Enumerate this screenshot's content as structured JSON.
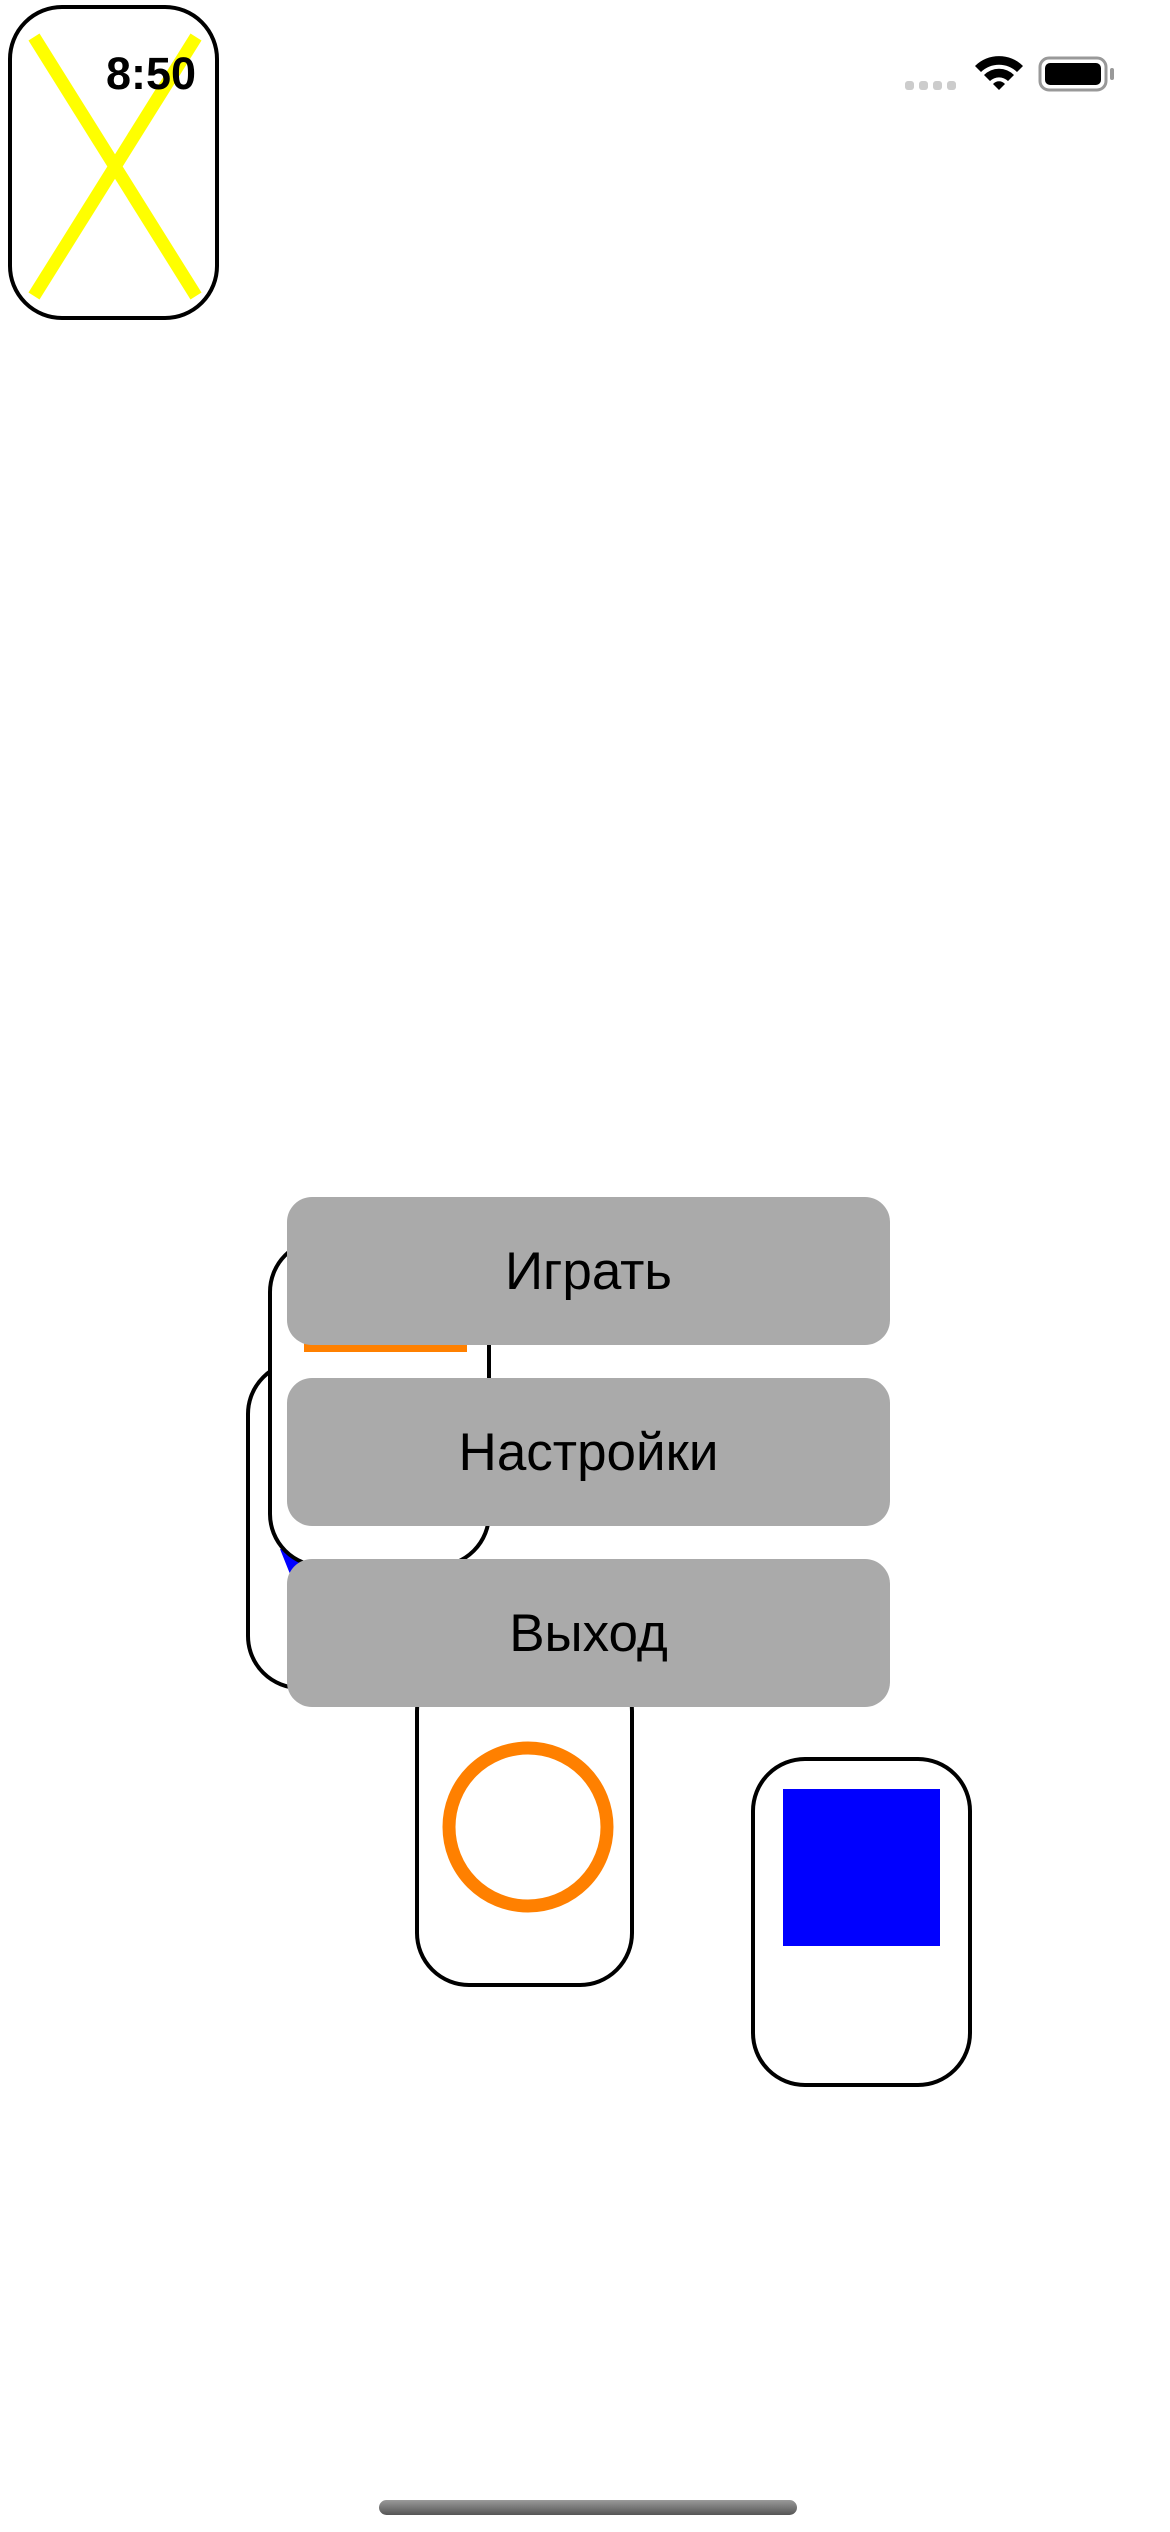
{
  "status_bar": {
    "time": "8:50",
    "icons": [
      "cellular-signal-icon",
      "wifi-icon",
      "battery-icon"
    ]
  },
  "game_cards": [
    {
      "name": "card-cross",
      "symbol": "cross",
      "color": "#ffff00"
    },
    {
      "name": "card-back-stacked",
      "symbol": "none",
      "color": "#0000ff"
    },
    {
      "name": "card-square-orange",
      "symbol": "square",
      "color": "#ff8000"
    },
    {
      "name": "card-circle",
      "symbol": "circle",
      "color": "#ff8000"
    },
    {
      "name": "card-square-blue",
      "symbol": "square",
      "color": "#0000ff"
    }
  ],
  "menu": {
    "play_label": "Играть",
    "settings_label": "Настройки",
    "exit_label": "Выход"
  },
  "colors": {
    "button_background": "#aaaaaa",
    "card_border": "#000000",
    "yellow": "#ffff00",
    "orange": "#ff8000",
    "blue": "#0000ff"
  }
}
